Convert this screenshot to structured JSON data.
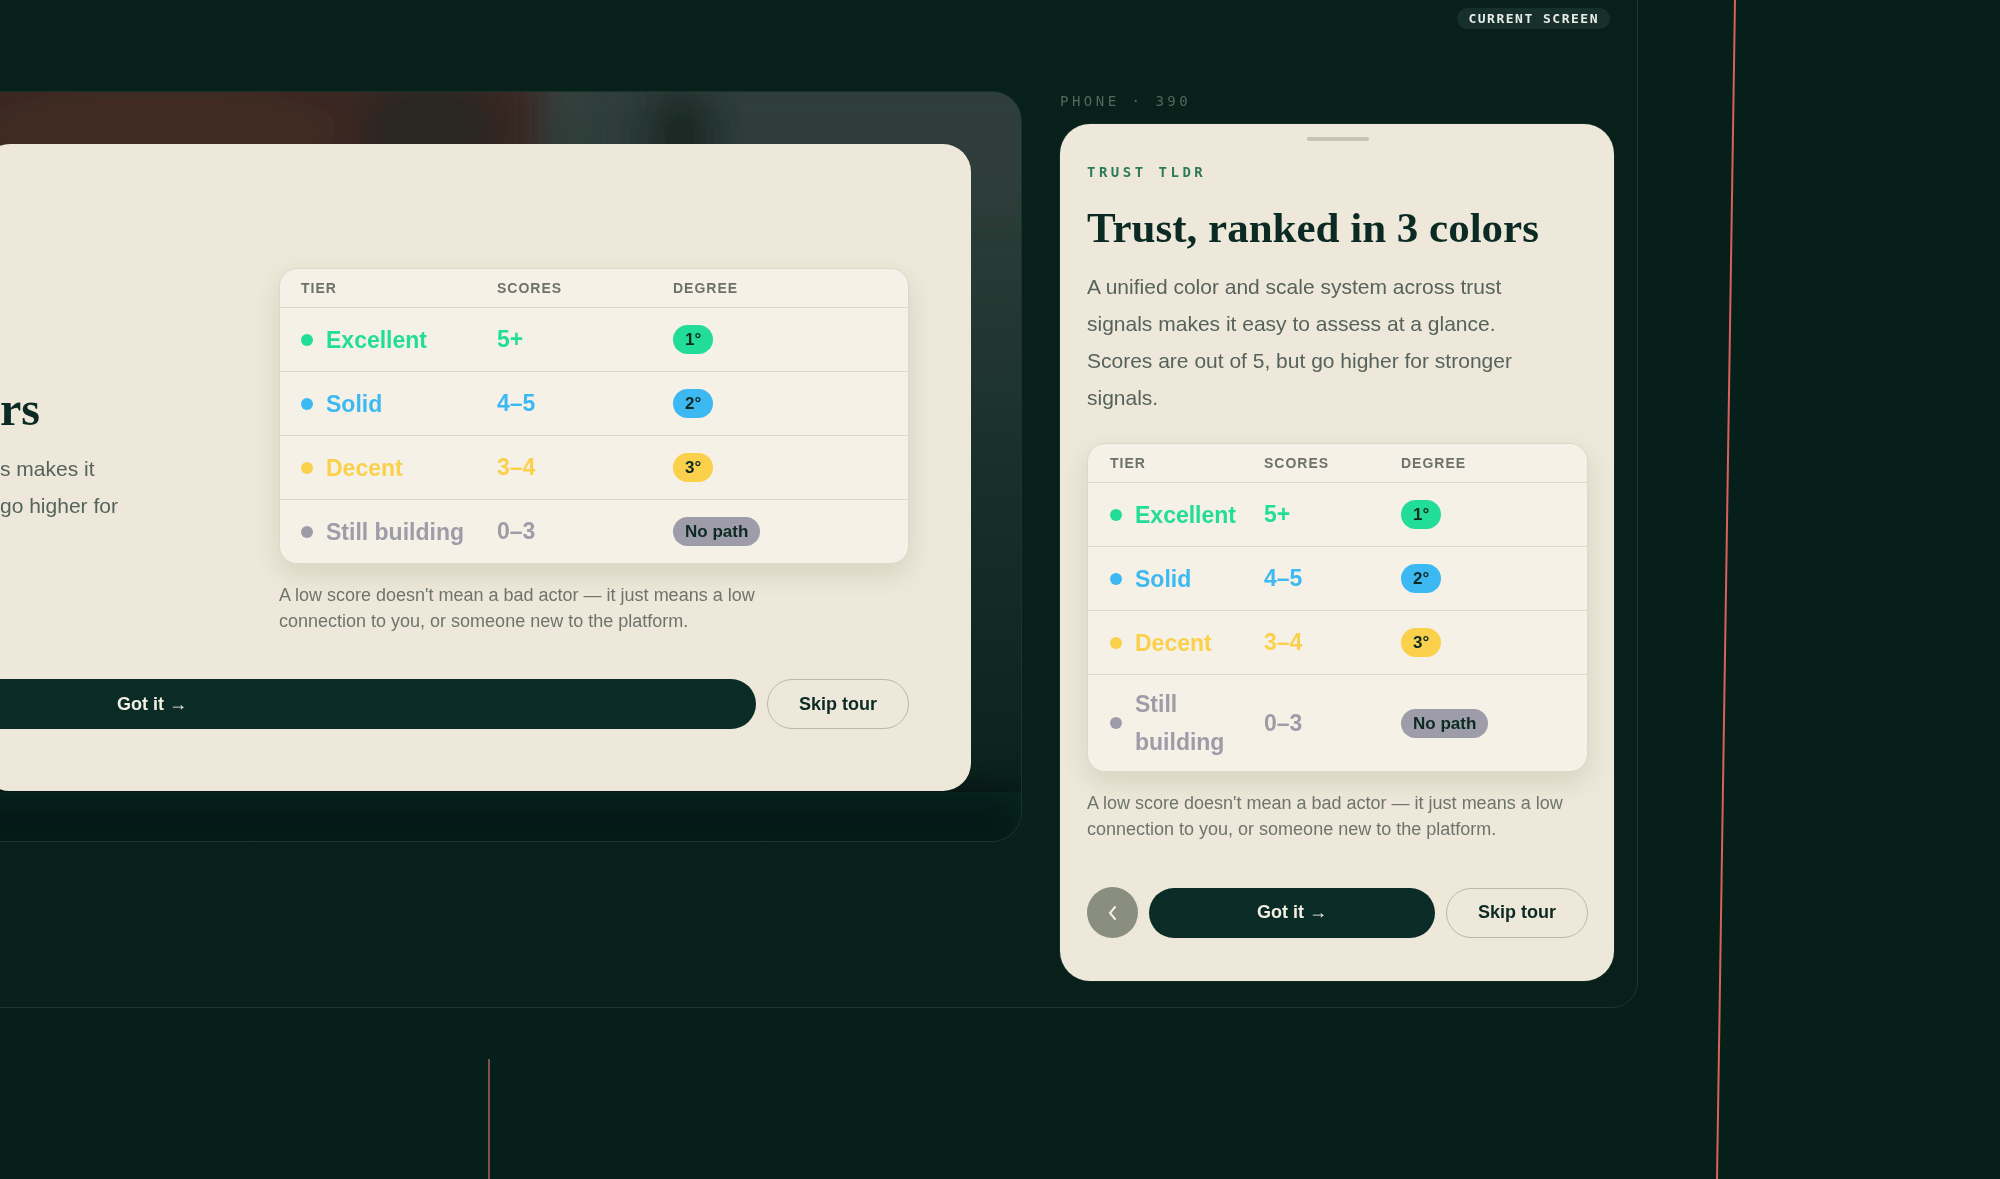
{
  "badge": {
    "label": "CURRENT SCREEN"
  },
  "desktop_preview": {
    "heading": "rs",
    "body_lines": [
      "s makes it",
      "go higher for"
    ],
    "table": {
      "columns": [
        "TIER",
        "SCORES",
        "DEGREE"
      ],
      "rows": [
        {
          "tier": "Excellent",
          "score": "5+",
          "degree": "1°",
          "color": "#22dd98"
        },
        {
          "tier": "Solid",
          "score": "4–5",
          "degree": "2°",
          "color": "#3cb8f2"
        },
        {
          "tier": "Decent",
          "score": "3–4",
          "degree": "3°",
          "color": "#fbd04b"
        },
        {
          "tier": "Still building",
          "score": "0–3",
          "degree": "No path",
          "color": "#9d9ca8"
        }
      ]
    },
    "note": "A low score doesn't mean a bad actor — it just means a low connection to you, or someone new to the platform.",
    "buttons": [
      {
        "label": "Got it →",
        "kind": "primary"
      },
      {
        "label": "Skip tour",
        "kind": "secondary"
      }
    ]
  },
  "phone_preview": {
    "label": "PHONE · 390",
    "eyebrow": "TRUST TLDR",
    "heading": "Trust, ranked in 3 colors",
    "body": "A unified color and scale system across trust signals makes it easy to assess at a glance. Scores are out of 5, but go higher for stronger signals.",
    "table": {
      "columns": [
        "TIER",
        "SCORES",
        "DEGREE"
      ],
      "rows": [
        {
          "tier": "Excellent",
          "score": "5+",
          "degree": "1°",
          "color": "#22dd98"
        },
        {
          "tier": "Solid",
          "score": "4–5",
          "degree": "2°",
          "color": "#3cb8f2"
        },
        {
          "tier": "Decent",
          "score": "3–4",
          "degree": "3°",
          "color": "#fbd04b"
        },
        {
          "tier": "Still building",
          "score": "0–3",
          "degree": "No path",
          "color": "#9d9ca8"
        }
      ]
    },
    "note": "A low score doesn't mean a bad actor — it just means a low connection to you, or someone new to the platform.",
    "buttons": [
      {
        "kind": "back"
      },
      {
        "label": "Got it →",
        "kind": "primary"
      },
      {
        "label": "Skip tour",
        "kind": "secondary"
      }
    ]
  }
}
